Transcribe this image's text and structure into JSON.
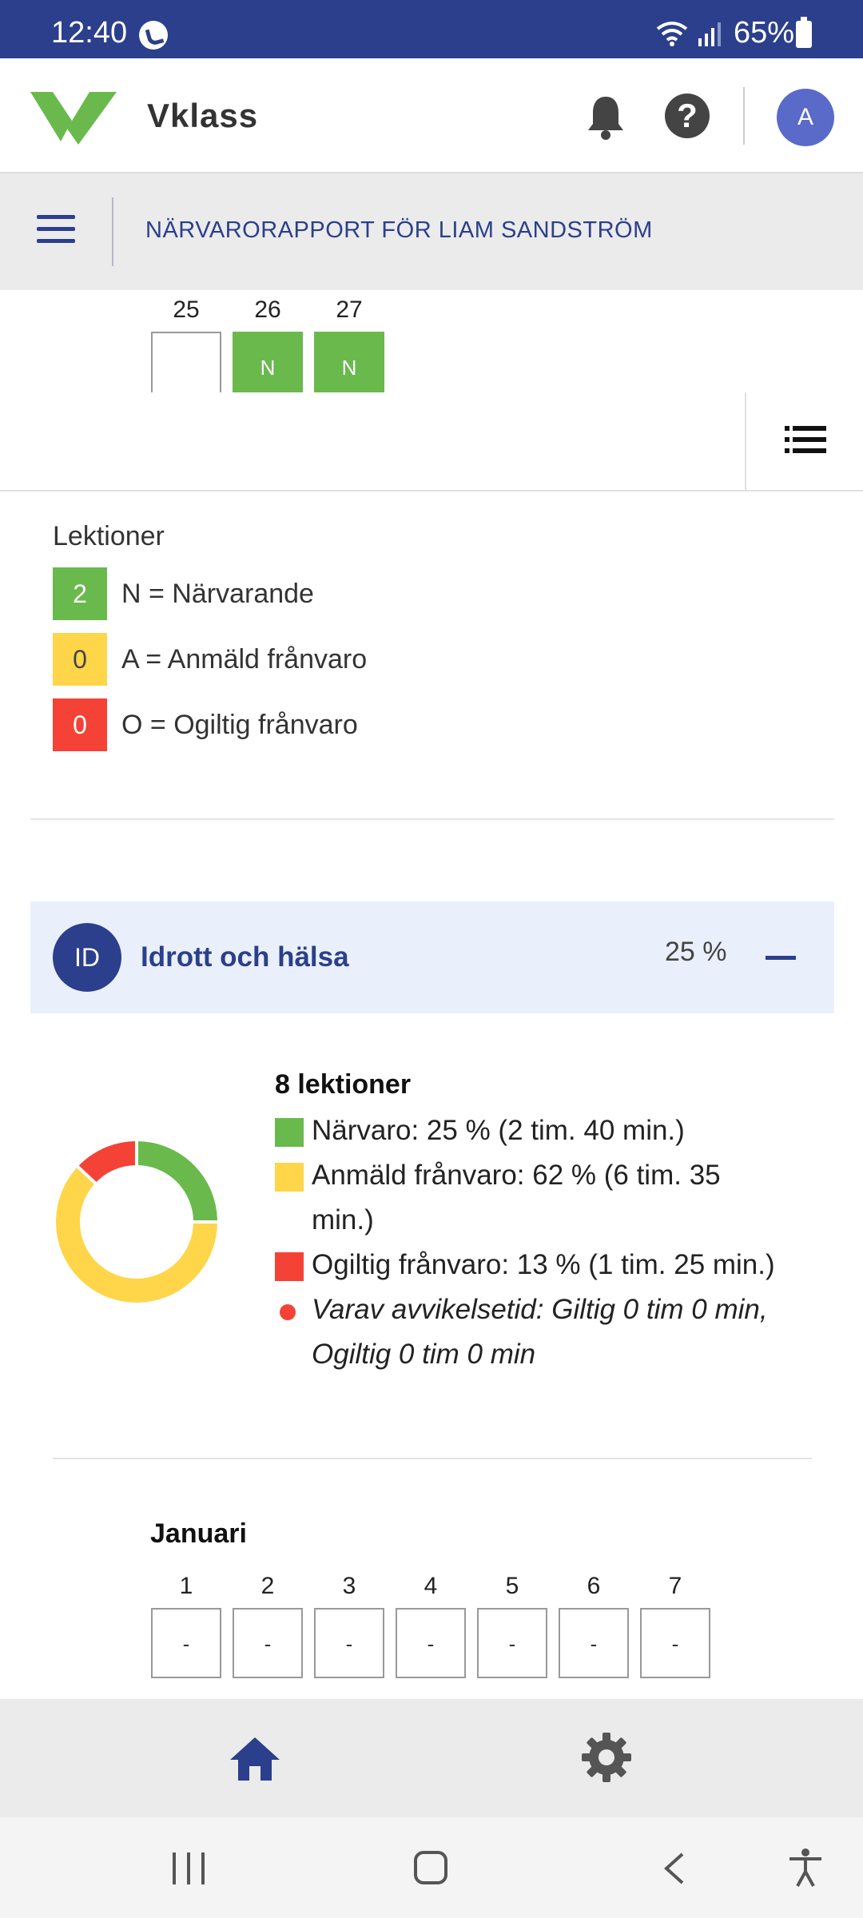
{
  "status_bar": {
    "time": "12:40",
    "battery": "65%"
  },
  "header": {
    "app_name": "Vklass",
    "avatar_initial": "A"
  },
  "title_bar": {
    "title": "NÄRVARORAPPORT FÖR LIAM SANDSTRÖM"
  },
  "top_calendar": {
    "days": [
      {
        "num": "25",
        "mark": ""
      },
      {
        "num": "26",
        "mark": "N"
      },
      {
        "num": "27",
        "mark": "N"
      }
    ]
  },
  "legend": {
    "title": "Lektioner",
    "items": [
      {
        "count": "2",
        "label": "N = Närvarande",
        "color": "#6ab94d"
      },
      {
        "count": "0",
        "label": "A = Anmäld frånvaro",
        "color": "#ffd54a"
      },
      {
        "count": "0",
        "label": "O = Ogiltig frånvaro",
        "color": "#f44336"
      }
    ]
  },
  "subject": {
    "badge": "ID",
    "name": "Idrott och hälsa",
    "percent": "25 %"
  },
  "stats": {
    "lessons": "8 lektioner",
    "presence": "Närvaro: 25 % (2 tim. 40 min.)",
    "reported_absence": "Anmäld frånvaro: 62 % (6 tim. 35 min.)",
    "invalid_absence": "Ogiltig frånvaro: 13 % (1 tim. 25 min.)",
    "deviation": "Varav avvikelsetid: Giltig 0 tim 0 min, Ogiltig 0 tim 0 min"
  },
  "chart_data": {
    "type": "pie",
    "categories": [
      "Närvaro",
      "Anmäld frånvaro",
      "Ogiltig frånvaro"
    ],
    "values": [
      25,
      62,
      13
    ],
    "colors": [
      "#6ab94d",
      "#ffd54a",
      "#f44336"
    ],
    "donut": true
  },
  "month": {
    "name": "Januari",
    "days": [
      {
        "num": "1",
        "value": "-"
      },
      {
        "num": "2",
        "value": "-"
      },
      {
        "num": "3",
        "value": "-"
      },
      {
        "num": "4",
        "value": "-"
      },
      {
        "num": "5",
        "value": "-"
      },
      {
        "num": "6",
        "value": "-"
      },
      {
        "num": "7",
        "value": "-"
      }
    ]
  }
}
